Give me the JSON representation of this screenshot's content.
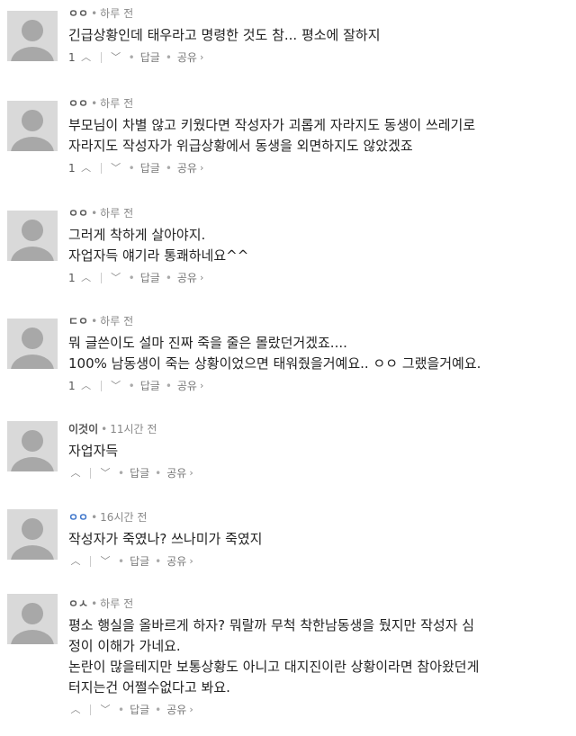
{
  "comments": [
    {
      "author": "ㅇㅇ",
      "time": "하루 전",
      "lines": [
        "긴급상황인데 태우라고 명령한 것도 참... 평소에 잘하지"
      ],
      "likes": "1",
      "reply_label": "답글",
      "share_label": "공유"
    },
    {
      "author": "ㅇㅇ",
      "time": "하루 전",
      "lines": [
        "부모님이 차별 않고 키웠다면 작성자가 괴롭게 자라지도 동생이 쓰레기로",
        "자라지도 작성자가 위급상황에서 동생을 외면하지도 않았겠죠"
      ],
      "likes": "1",
      "reply_label": "답글",
      "share_label": "공유"
    },
    {
      "author": "ㅇㅇ",
      "time": "하루 전",
      "lines": [
        "그러게 착하게 살아야지.",
        "자업자득 얘기라 통쾌하네요^^"
      ],
      "likes": "1",
      "reply_label": "답글",
      "share_label": "공유"
    },
    {
      "author": "ㄷㅇ",
      "time": "하루 전",
      "lines": [
        "뭐 글쓴이도 설마 진짜 죽을 줄은 몰랐던거겠죠....",
        "100% 남동생이 죽는 상황이었으면 태워줬을거예요.. ㅇㅇ 그랬을거예요."
      ],
      "likes": "1",
      "reply_label": "답글",
      "share_label": "공유"
    },
    {
      "author": "이것이",
      "time": "11시간 전",
      "lines": [
        "자업자득"
      ],
      "likes": "",
      "reply_label": "답글",
      "share_label": "공유"
    },
    {
      "author": "ㅇㅇ",
      "time": "16시간 전",
      "lines": [
        "작성자가 죽였나? 쓰나미가 죽였지"
      ],
      "likes": "",
      "reply_label": "답글",
      "share_label": "공유",
      "author_color": "#3b73c9"
    },
    {
      "author": "ㅇㅅ",
      "time": "하루 전",
      "lines": [
        "평소 행실을 올바르게 하자? 뭐랄까 무척 착한남동생을 뒀지만 작성자 심",
        "정이 이해가 가네요.",
        "논란이 많을테지만 보통상황도 아니고 대지진이란 상황이라면 참아왔던게",
        "터지는건 어쩔수없다고 봐요."
      ],
      "likes": "",
      "reply_label": "답글",
      "share_label": "공유"
    }
  ],
  "icons": {
    "upvote": "chevron-up-icon",
    "downvote": "chevron-down-icon",
    "share": "chevron-right-icon"
  }
}
